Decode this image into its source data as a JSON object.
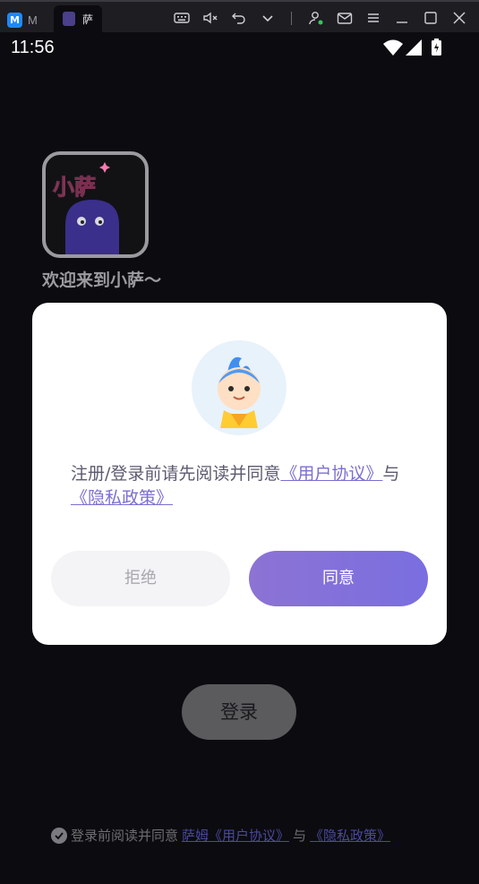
{
  "emulator": {
    "tabs": [
      {
        "label": "M",
        "active": false,
        "icon": "app-logo-icon"
      },
      {
        "label": "萨",
        "active": true,
        "icon": "app-thumbnail-icon"
      }
    ],
    "toolbar_icons": [
      "keyboard-icon",
      "volume-mute-icon",
      "undo-icon",
      "chevron-down-icon",
      "account-icon",
      "mail-icon",
      "menu-icon",
      "minimize-icon",
      "maximize-icon",
      "close-icon"
    ]
  },
  "status_bar": {
    "time": "11:56",
    "icons": [
      "wifi-icon",
      "signal-icon",
      "battery-charging-icon"
    ]
  },
  "app": {
    "logo_text": "小萨",
    "welcome": "欢迎来到小萨～",
    "login_button": "登录",
    "bottom_agreement": {
      "prefix": "登录前阅读并同意",
      "link1": "萨姆《用户协议》",
      "mid": "与",
      "link2": "《隐私政策》"
    }
  },
  "dialog": {
    "text_prefix": "注册/登录前请先阅读并同意",
    "link1": "《用户协议》",
    "mid": "与",
    "link2": "《隐私政策》",
    "reject_label": "拒绝",
    "agree_label": "同意"
  },
  "colors": {
    "accent": "#7b6fd1",
    "agree_gradient_start": "#8c73d4",
    "agree_gradient_end": "#7a6ee0"
  }
}
